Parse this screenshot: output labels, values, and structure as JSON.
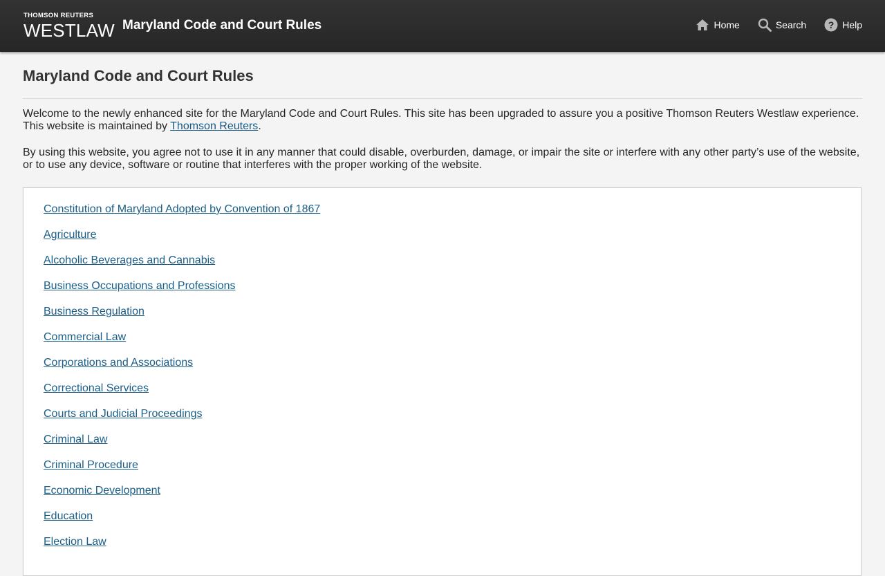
{
  "header": {
    "brand_top": "THOMSON REUTERS",
    "brand_main": "WESTLAW",
    "site_title": "Maryland Code and Court Rules",
    "nav": {
      "home": "Home",
      "search": "Search",
      "help": "Help"
    }
  },
  "main": {
    "title": "Maryland Code and Court Rules",
    "intro_part1": "Welcome to the newly enhanced site for the Maryland Code and Court Rules. This site has been upgraded to assure you a positive Thomson Reuters Westlaw experience. This website is maintained by ",
    "intro_link": "Thomson Reuters",
    "intro_part2": ".",
    "terms": "By using this website, you agree not to use it in any manner that could disable, overburden, damage, or impair the site or interfere with any other party’s use of the website, or to use any device, software or routine that interferes with the proper working of the website."
  },
  "toc": {
    "items": [
      "Constitution of Maryland Adopted by Convention of 1867",
      "Agriculture",
      "Alcoholic Beverages and Cannabis",
      "Business Occupations and Professions",
      "Business Regulation",
      "Commercial Law",
      "Corporations and Associations",
      "Correctional Services",
      "Courts and Judicial Proceedings",
      "Criminal Law",
      "Criminal Procedure",
      "Economic Development",
      "Education",
      "Election Law"
    ]
  },
  "colors": {
    "header_bg": "#2b2b2b",
    "link": "#1a5e87",
    "page_bg": "#f4f4f4"
  },
  "icons": {
    "home": "home-icon",
    "search": "search-icon",
    "help": "help-icon"
  }
}
